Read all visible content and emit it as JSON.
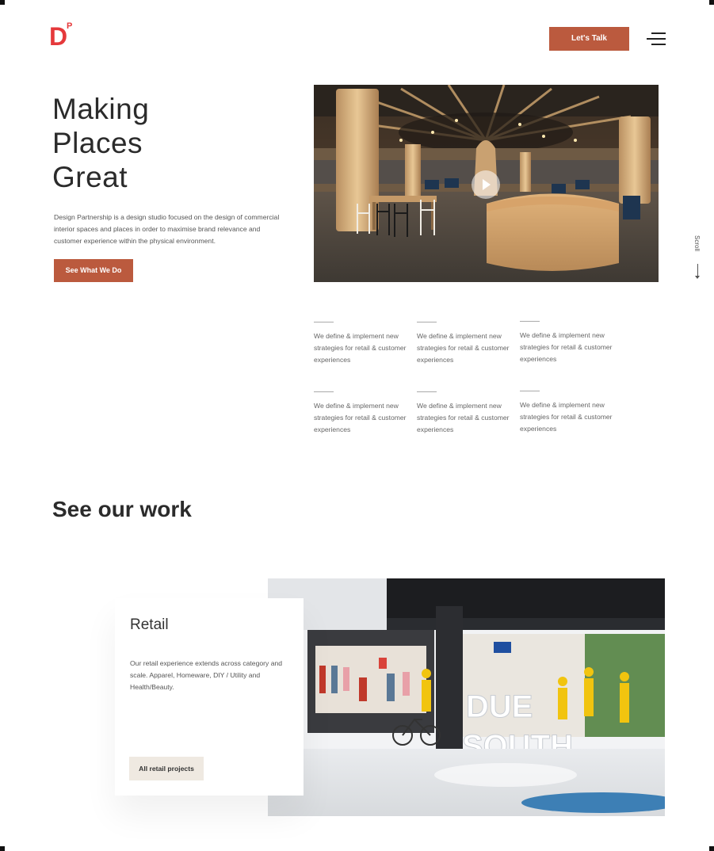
{
  "brand": {
    "logo_letter": "D",
    "logo_superscript": "P",
    "accent_color": "#bb5a3e",
    "logo_color": "#e5393b"
  },
  "header": {
    "cta_label": "Let's Talk",
    "menu_icon": "hamburger-menu-icon"
  },
  "hero": {
    "title_lines": [
      "Making",
      "Places",
      "Great"
    ],
    "description": "Design Partnership is a design studio focused on the design of commercial interior spaces and places in order to maximise brand relevance and customer experience within the physical environment.",
    "button_label": "See What We Do",
    "image_alt": "Food court interior with wooden tree sculpture and seating",
    "play_icon": "play-icon"
  },
  "scroll": {
    "label": "Scroll"
  },
  "features": [
    {
      "text": "We define & implement new strategies for retail & customer experiences"
    },
    {
      "text": "We define & implement new strategies for retail & customer experiences"
    },
    {
      "text": "We define & implement new strategies for retail & customer experiences"
    },
    {
      "text": "We define & implement new strategies for retail & customer experiences"
    },
    {
      "text": "We define & implement new strategies for retail & customer experiences"
    },
    {
      "text": "We define & implement new strategies for retail & customer experiences"
    }
  ],
  "work": {
    "heading": "See our work",
    "card": {
      "title": "Retail",
      "description": "Our retail experience extends across category and scale. Apparel, Homeware, DIY / Utility and Health/Beauty.",
      "button_label": "All retail projects"
    },
    "image_sign_text": [
      "DUE",
      "SOUTH"
    ]
  }
}
